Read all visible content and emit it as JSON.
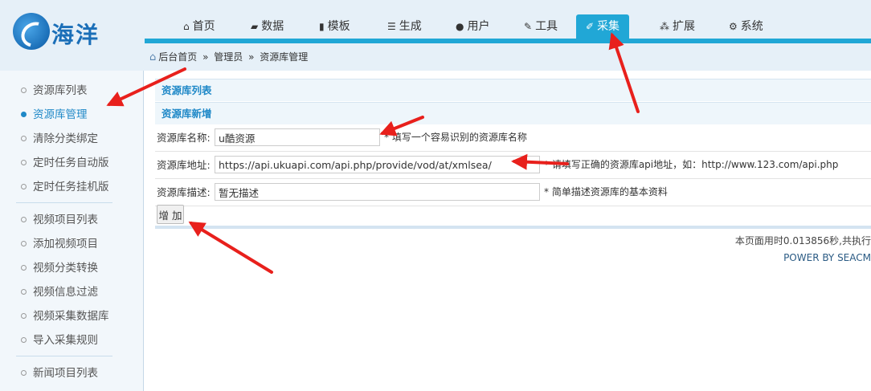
{
  "logo": {
    "text": "海洋"
  },
  "nav": {
    "items": [
      {
        "label": "首页",
        "icon": "home-icon"
      },
      {
        "label": "数据",
        "icon": "book-icon"
      },
      {
        "label": "模板",
        "icon": "file-icon"
      },
      {
        "label": "生成",
        "icon": "server-icon"
      },
      {
        "label": "用户",
        "icon": "user-icon"
      },
      {
        "label": "工具",
        "icon": "wrench-icon"
      },
      {
        "label": "采集",
        "icon": "edit-icon",
        "active": true
      },
      {
        "label": "扩展",
        "icon": "sitemap-icon"
      },
      {
        "label": "系统",
        "icon": "gear-icon"
      }
    ],
    "accent": "#21a7d6"
  },
  "breadcrumb": {
    "home": "后台首页",
    "sep": "»",
    "level1": "管理员",
    "level2": "资源库管理"
  },
  "sidebar": {
    "items": [
      {
        "label": "资源库列表"
      },
      {
        "label": "资源库管理",
        "active": true
      },
      {
        "label": "清除分类绑定"
      },
      {
        "label": "定时任务自动版"
      },
      {
        "label": "定时任务挂机版"
      },
      {
        "label": "视频项目列表"
      },
      {
        "label": "添加视频项目"
      },
      {
        "label": "视频分类转换"
      },
      {
        "label": "视频信息过滤"
      },
      {
        "label": "视频采集数据库"
      },
      {
        "label": "导入采集规则"
      },
      {
        "label": "新闻项目列表"
      }
    ]
  },
  "main": {
    "list_link": "资源库列表",
    "add_title": "资源库新增",
    "fields": {
      "name": {
        "label": "资源库名称:",
        "value": "u酷资源",
        "hint": "* 填写一个容易识别的资源库名称"
      },
      "url": {
        "label": "资源库地址:",
        "value": "https://api.ukuapi.com/api.php/provide/vod/at/xmlsea/",
        "hint": "* 请填写正确的资源库api地址，如：http://www.123.com/api.php"
      },
      "desc": {
        "label": "资源库描述:",
        "value": "暂无描述",
        "hint": "* 简单描述资源库的基本资料"
      }
    },
    "add_button": "增 加"
  },
  "footer": {
    "time_text": "本页面用时0.013856秒,共执行",
    "power_text": "POWER BY SEACM"
  },
  "colors": {
    "annotation_arrow": "#e8201c",
    "sidebar_active": "#1e88c7"
  }
}
